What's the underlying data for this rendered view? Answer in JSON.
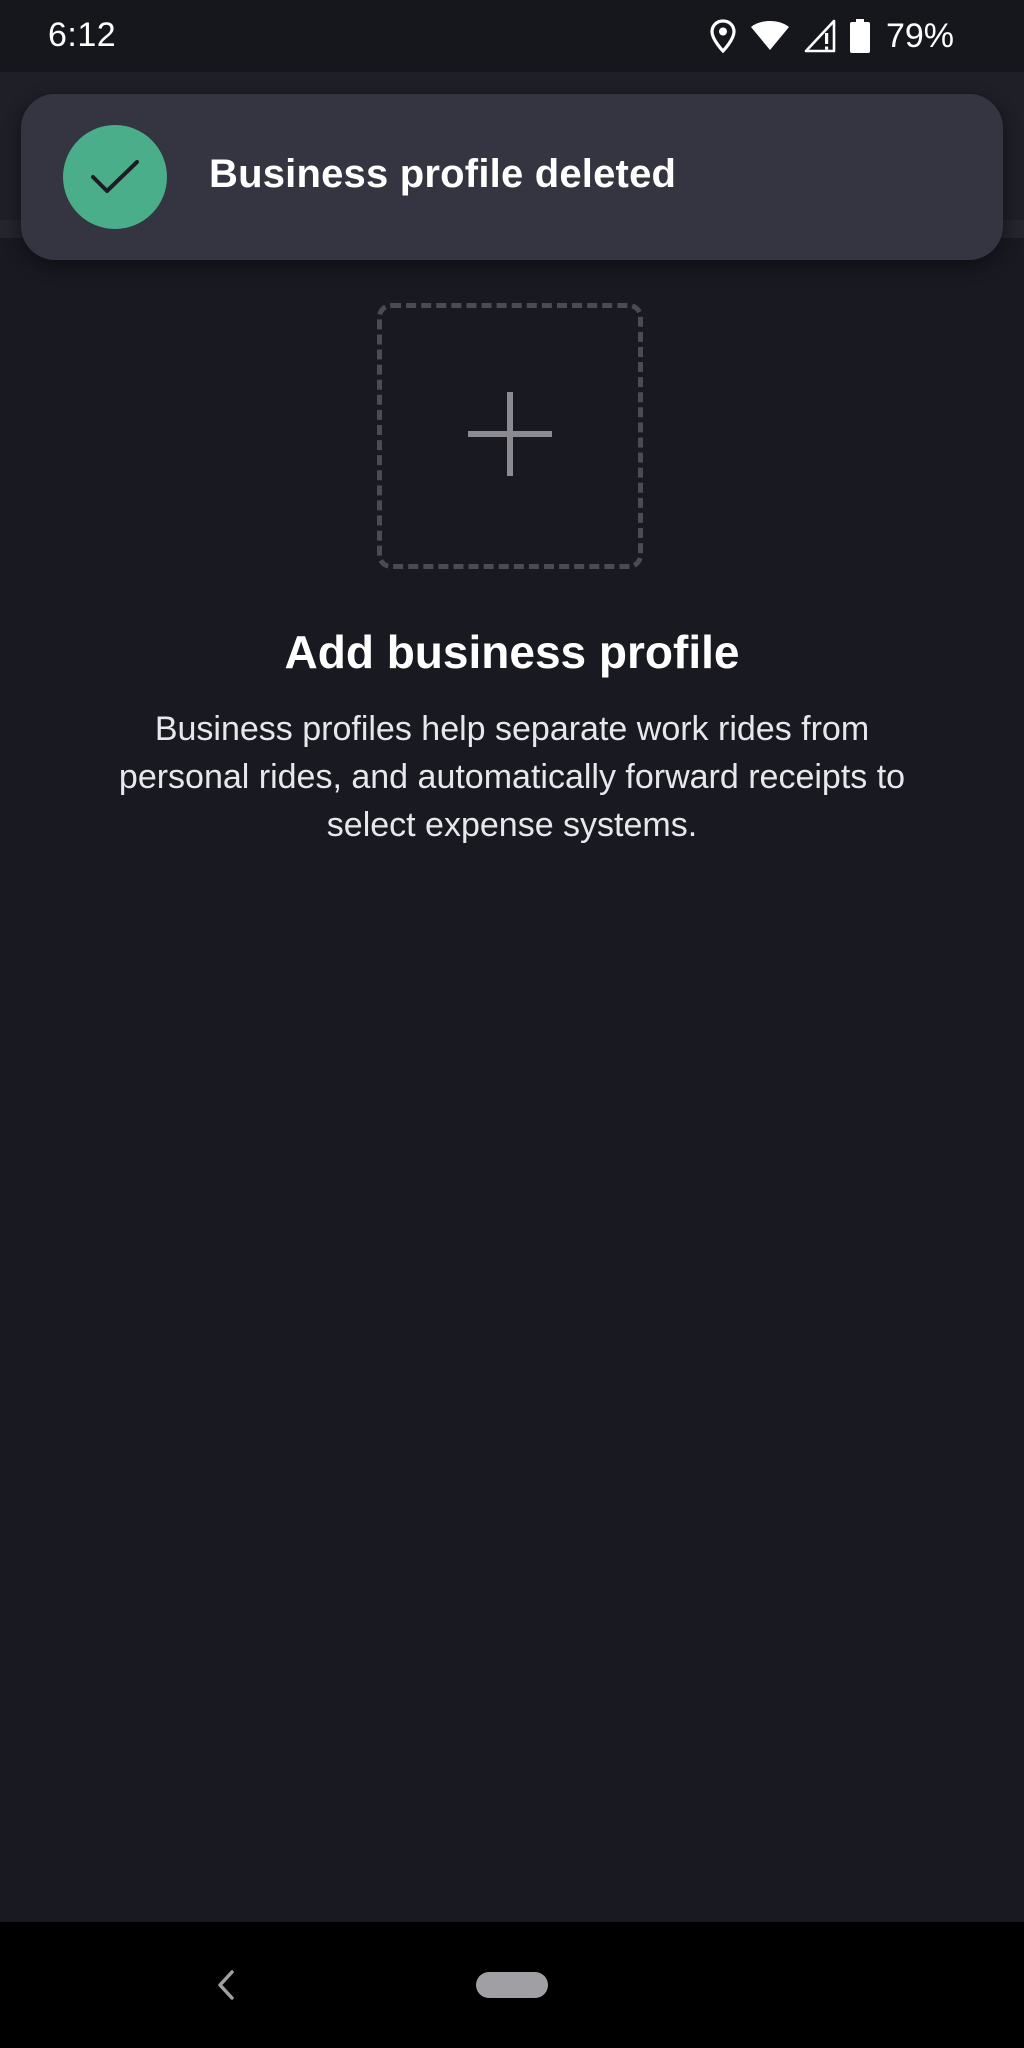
{
  "status_bar": {
    "time": "6:12",
    "battery_percent": "79%",
    "icons": [
      "location-icon",
      "wifi-icon",
      "signal-icon",
      "battery-icon"
    ]
  },
  "toast": {
    "message": "Business profile deleted",
    "icon": "check-icon",
    "accent_color": "#4bae8a"
  },
  "empty_state": {
    "title": "Add business profile",
    "description": "Business profiles help separate work rides from personal rides, and automatically forward receipts to select expense systems.",
    "add_icon": "plus-icon"
  },
  "nav_bar": {
    "back_icon": "back-chevron-icon",
    "home_icon": "home-pill-icon"
  },
  "colors": {
    "background": "#191a21",
    "toast_background": "#343541"
  }
}
